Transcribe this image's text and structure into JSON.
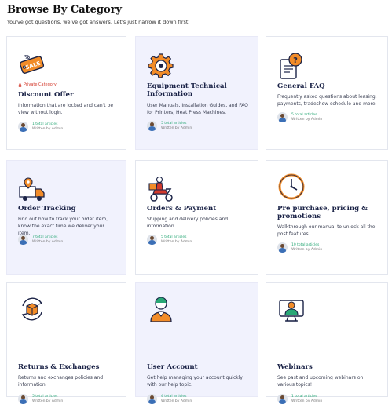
{
  "header": {
    "title": "Browse By Category",
    "subtitle": "You've got questions, we've got answers. Let's just narrow it down first."
  },
  "categories": [
    {
      "title": "Discount Offer",
      "badge": "Private Category",
      "description": "Information that are locked and can't be view without login.",
      "count": "1 total articles",
      "author": "Written by Admin",
      "icon": "sale-tag-icon"
    },
    {
      "title": "Equipment Technical Information",
      "description": "User Manuals, Installation Guides, and FAQ for Printers, Heat Press Machines.",
      "count": "5 total articles",
      "author": "Written by Admin",
      "icon": "gear-icon"
    },
    {
      "title": "General FAQ",
      "description": "Frequently asked questions about leasing, payments, tradeshow schedule and more.",
      "count": "5 total articles",
      "author": "Written by Admin",
      "icon": "faq-document-icon"
    },
    {
      "title": "Order Tracking",
      "description": "Find out how to track your order item, know the exact time we deliver your item.",
      "count": "7 total articles",
      "author": "Written by Admin",
      "icon": "delivery-truck-icon"
    },
    {
      "title": "Orders & Payment",
      "description": "Shipping and delivery policies and information.",
      "count": "5 total articles",
      "author": "Written by Admin",
      "icon": "delivery-scooter-icon"
    },
    {
      "title": "Pre purchase, pricing & promotions",
      "description": "Walkthrough our manual to unlock all the post features.",
      "count": "10 total articles",
      "author": "Written by Admin",
      "icon": "clock-icon"
    },
    {
      "title": "Returns & Exchanges",
      "description": "Returns and exchanges policies and information.",
      "count": "5 total articles",
      "author": "Written by Admin",
      "icon": "return-box-icon"
    },
    {
      "title": "User Account",
      "description": "Get help managing your account quickly with our help topic.",
      "count": "4 total articles",
      "author": "Written by Admin",
      "icon": "user-account-icon"
    },
    {
      "title": "Webinars",
      "description": "See past and upcoming webinars on various topics!",
      "count": "1 total articles",
      "author": "Written by Admin",
      "icon": "webinar-icon"
    }
  ],
  "colors": {
    "accent_orange": "#f28c28",
    "title_navy": "#1b2347",
    "count_green": "#2aa876",
    "private_red": "#d33a2c",
    "tint_card": "#f1f2fd"
  }
}
